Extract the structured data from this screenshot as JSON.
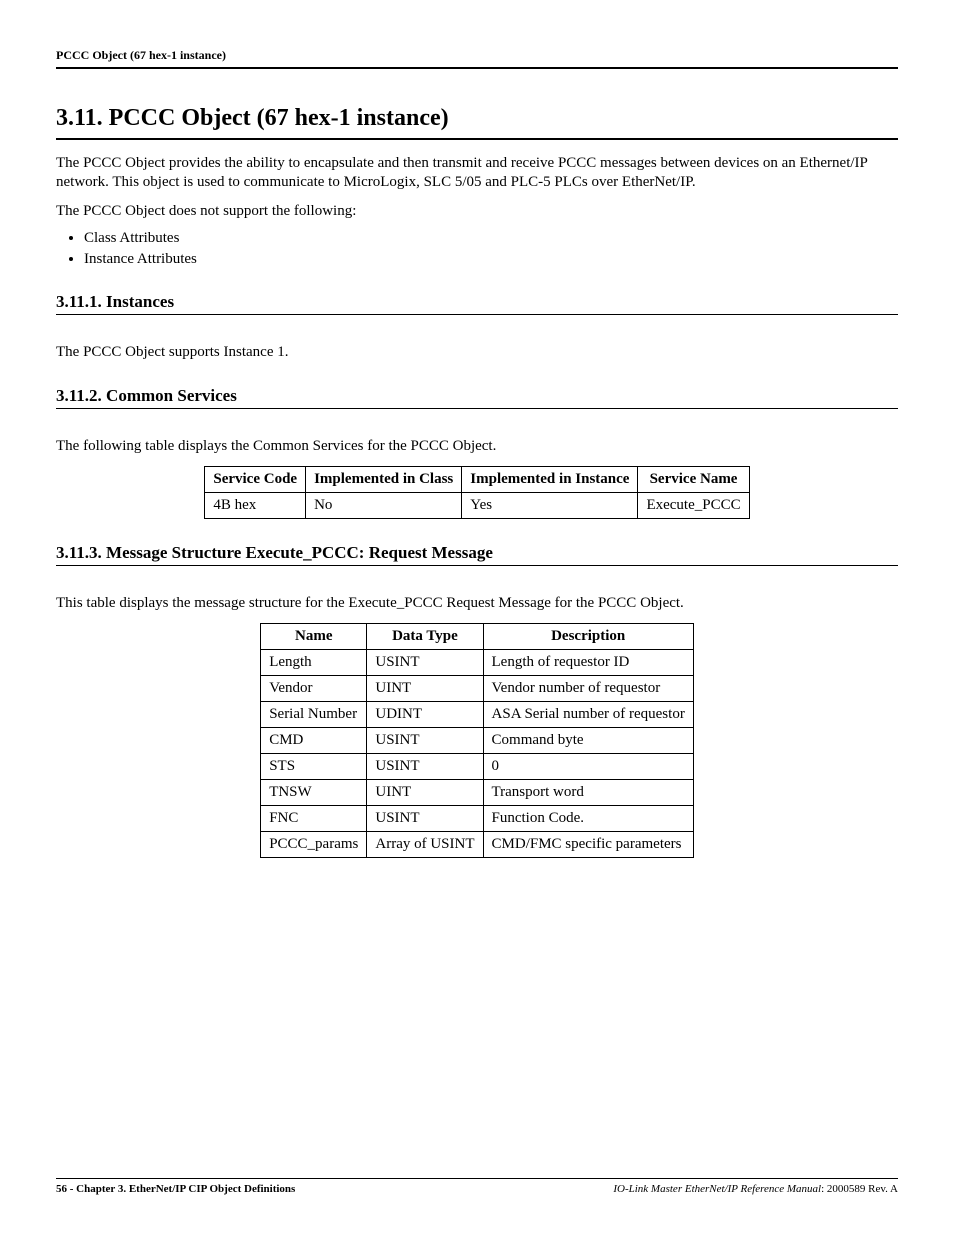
{
  "header": {
    "running": "PCCC Object (67 hex-1 instance)"
  },
  "section": {
    "number_title": "3.11. PCCC Object (67 hex-1 instance)",
    "intro1": "The PCCC Object provides the ability to encapsulate and then transmit and receive PCCC messages between devices on an Ethernet/IP network.  This object is used to communicate to MicroLogix, SLC 5/05 and PLC-5 PLCs over EtherNet/IP.",
    "intro2": "The PCCC Object does not support the following:",
    "not_support": [
      "Class Attributes",
      "Instance Attributes"
    ]
  },
  "sub1": {
    "heading": "3.11.1. Instances",
    "text": "The PCCC Object supports Instance 1."
  },
  "sub2": {
    "heading": "3.11.2. Common Services",
    "text": "The following table displays the Common Services for the PCCC Object.",
    "table": {
      "headers": [
        "Service Code",
        "Implemented in Class",
        "Implemented in Instance",
        "Service Name"
      ],
      "rows": [
        [
          "4B hex",
          "No",
          "Yes",
          "Execute_PCCC"
        ]
      ]
    }
  },
  "sub3": {
    "heading": "3.11.3. Message Structure Execute_PCCC: Request Message",
    "text": "This table displays the message structure for the Execute_PCCC Request Message for the PCCC Object.",
    "table": {
      "headers": [
        "Name",
        "Data Type",
        "Description"
      ],
      "rows": [
        [
          "Length",
          "USINT",
          "Length of requestor ID"
        ],
        [
          "Vendor",
          "UINT",
          "Vendor number of requestor"
        ],
        [
          "Serial Number",
          "UDINT",
          "ASA Serial number of requestor"
        ],
        [
          "CMD",
          "USINT",
          "Command byte"
        ],
        [
          "STS",
          "USINT",
          "0"
        ],
        [
          "TNSW",
          "UINT",
          "Transport word"
        ],
        [
          "FNC",
          "USINT",
          "Function Code."
        ],
        [
          "PCCC_params",
          "Array of USINT",
          "CMD/FMC specific parameters"
        ]
      ]
    }
  },
  "footer": {
    "left_page": "56",
    "left_text": " - Chapter 3. EtherNet/IP CIP Object Definitions",
    "right_ital": "IO-Link Master EtherNet/IP Reference Manual",
    "right_rest": ": 2000589 Rev. A"
  }
}
